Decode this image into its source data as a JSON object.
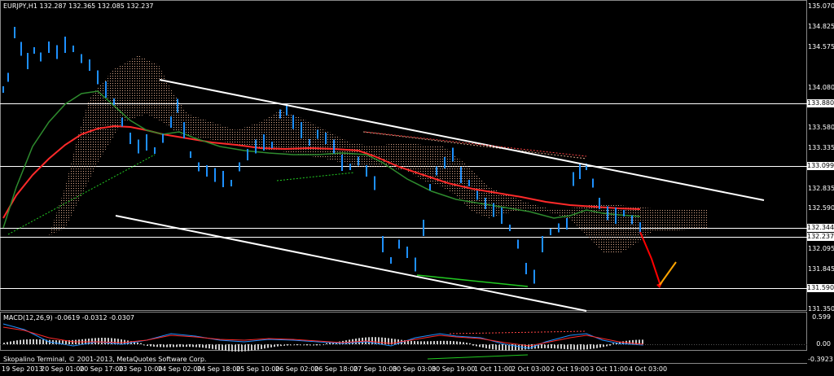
{
  "header": {
    "symbol_line": "EURJPY,H1  132.287 132.365 132.085 132.237"
  },
  "macd": {
    "label": "MACD(12,26,9) -0.0619 -0.0312 -0.0307",
    "scale": [
      "0.599",
      "0.00",
      "-0.3923"
    ]
  },
  "footer": "Skopalino Terminal, © 2001-2013, MetaQuotes Software Corp.",
  "price_axis": [
    "135.070",
    "134.825",
    "134.575",
    "134.080",
    "133.830",
    "133.580",
    "133.335",
    "132.835",
    "132.590",
    "132.095",
    "131.845",
    "131.350"
  ],
  "price_tags": [
    {
      "text": "133.880",
      "key": "resistance_high"
    },
    {
      "text": "133.099",
      "key": "resistance_mid"
    },
    {
      "text": "132.344",
      "key": "current_ask"
    },
    {
      "text": "132.237",
      "key": "current_bid"
    },
    {
      "text": "131.590",
      "key": "support_low"
    }
  ],
  "time_axis": [
    "19 Sep 2013",
    "20 Sep 01:00",
    "20 Sep 17:00",
    "23 Sep 10:00",
    "24 Sep 02:00",
    "24 Sep 18:00",
    "25 Sep 10:00",
    "26 Sep 02:00",
    "26 Sep 18:00",
    "27 Sep 10:00",
    "30 Sep 03:00",
    "30 Sep 19:00",
    "1 Oct 11:00",
    "2 Oct 03:00",
    "2 Oct 19:00",
    "3 Oct 11:00",
    "4 Oct 03:00"
  ],
  "colors": {
    "background": "#000000",
    "candle": "#1e90ff",
    "ma_red": "#ff2a2a",
    "ma_green": "#2e8b2e",
    "cloud": "#d9a68a",
    "channel": "#ffffff",
    "macd_blue": "#1e90ff",
    "macd_red": "#ff2a2a",
    "arrow_red": "#ff0000",
    "arrow_orange": "#ffa500"
  }
}
